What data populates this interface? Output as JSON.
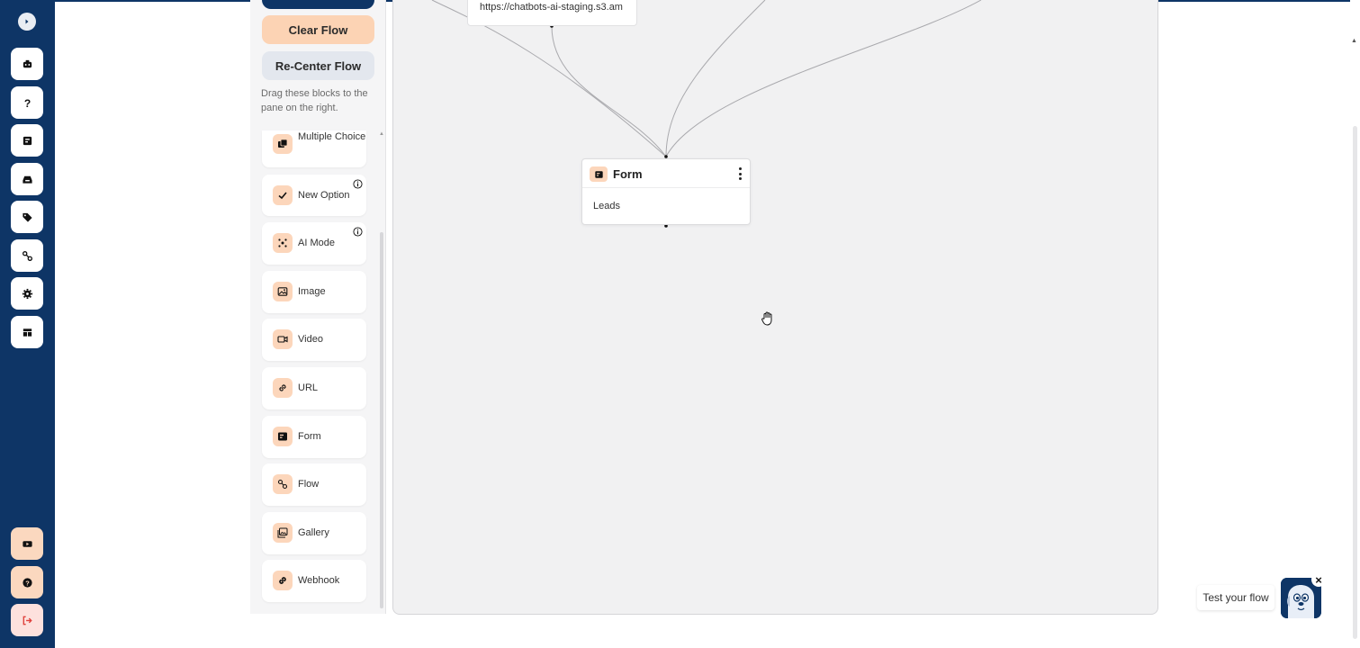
{
  "sidebar": {
    "toggle_icon": "chevron-right-icon",
    "items": [
      {
        "name": "chatbots",
        "icon": "robot-icon"
      },
      {
        "name": "faq",
        "icon": "question-icon"
      },
      {
        "name": "forms",
        "icon": "form-icon"
      },
      {
        "name": "inbox",
        "icon": "inbox-icon"
      },
      {
        "name": "tags",
        "icon": "tag-icon"
      },
      {
        "name": "flows",
        "icon": "flow-icon"
      },
      {
        "name": "settings",
        "icon": "gear-icon"
      },
      {
        "name": "templates",
        "icon": "layout-icon"
      }
    ],
    "bottom_items": [
      {
        "name": "tutorials",
        "icon": "video-icon"
      },
      {
        "name": "help",
        "icon": "help-circle-icon"
      },
      {
        "name": "logout",
        "icon": "logout-icon"
      }
    ]
  },
  "panel": {
    "clear_flow_label": "Clear Flow",
    "recenter_flow_label": "Re-Center Flow",
    "hint": "Drag these blocks to the pane on the right.",
    "blocks": [
      {
        "label": "Multiple Choice",
        "icon": "multiple-choice-icon",
        "info": false
      },
      {
        "label": "New Option",
        "icon": "check-icon",
        "info": true
      },
      {
        "label": "AI Mode",
        "icon": "ai-icon",
        "info": true
      },
      {
        "label": "Image",
        "icon": "image-icon",
        "info": false
      },
      {
        "label": "Video",
        "icon": "video-icon",
        "info": false
      },
      {
        "label": "URL",
        "icon": "link-icon",
        "info": false
      },
      {
        "label": "Form",
        "icon": "form-icon",
        "info": false
      },
      {
        "label": "Flow",
        "icon": "flow-icon",
        "info": false
      },
      {
        "label": "Gallery",
        "icon": "gallery-icon",
        "info": false
      },
      {
        "label": "Webhook",
        "icon": "webhook-icon",
        "info": false
      }
    ]
  },
  "canvas": {
    "partial_node_text": "https://chatbots-ai-staging.s3.am",
    "form_node": {
      "title": "Form",
      "body": "Leads"
    }
  },
  "test_widget": {
    "label": "Test your flow",
    "close": "×"
  },
  "colors": {
    "navy": "#0e3566",
    "peach": "#fcd3b4",
    "canvas": "#f1f1f2"
  }
}
